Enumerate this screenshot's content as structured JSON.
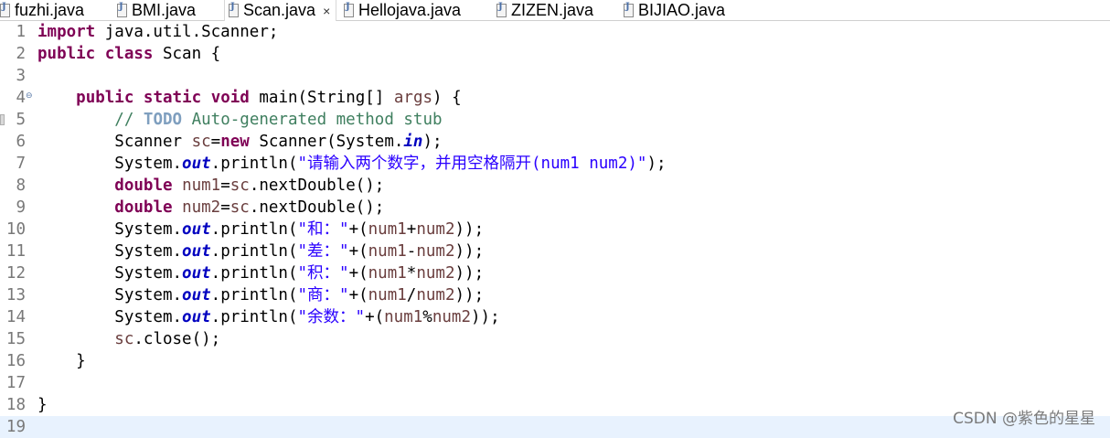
{
  "tabs": [
    {
      "label": "fuzhi.java",
      "active": false
    },
    {
      "label": "BMI.java",
      "active": false
    },
    {
      "label": "Scan.java",
      "active": true
    },
    {
      "label": "Hellojava.java",
      "active": false
    },
    {
      "label": "ZIZEN.java",
      "active": false
    },
    {
      "label": "BIJIAO.java",
      "active": false
    }
  ],
  "close_glyph": "×",
  "colors": {
    "keyword": "#7f0055",
    "static_field": "#0000c0",
    "string": "#2a00ff",
    "comment": "#3f7f5f",
    "todo": "#7f9fbf",
    "variable": "#6a3e3e",
    "current_line": "#e8f2fe"
  },
  "editor": {
    "current_line": 19,
    "lines": [
      {
        "n": "1",
        "tokens": [
          {
            "t": "import",
            "c": "kw"
          },
          {
            "t": " java.util.Scanner;"
          }
        ]
      },
      {
        "n": "2",
        "tokens": [
          {
            "t": "public",
            "c": "kw"
          },
          {
            "t": " "
          },
          {
            "t": "class",
            "c": "kw"
          },
          {
            "t": " Scan {"
          }
        ]
      },
      {
        "n": "3",
        "tokens": []
      },
      {
        "n": "4",
        "fold": "⊖",
        "tokens": [
          {
            "t": "    "
          },
          {
            "t": "public",
            "c": "kw"
          },
          {
            "t": " "
          },
          {
            "t": "static",
            "c": "kw"
          },
          {
            "t": " "
          },
          {
            "t": "void",
            "c": "kw"
          },
          {
            "t": " main(String[] "
          },
          {
            "t": "args",
            "c": "var"
          },
          {
            "t": ") {"
          }
        ]
      },
      {
        "n": "5",
        "marker": true,
        "tokens": [
          {
            "t": "        "
          },
          {
            "t": "// ",
            "c": "cm"
          },
          {
            "t": "TODO",
            "c": "todo"
          },
          {
            "t": " Auto-generated method stub",
            "c": "cm"
          }
        ]
      },
      {
        "n": "6",
        "tokens": [
          {
            "t": "        Scanner "
          },
          {
            "t": "sc",
            "c": "var"
          },
          {
            "t": "="
          },
          {
            "t": "new",
            "c": "kw"
          },
          {
            "t": " Scanner(System."
          },
          {
            "t": "in",
            "c": "fld"
          },
          {
            "t": ");"
          }
        ]
      },
      {
        "n": "7",
        "tokens": [
          {
            "t": "        System."
          },
          {
            "t": "out",
            "c": "fld"
          },
          {
            "t": ".println("
          },
          {
            "t": "\"请输入两个数字，并用空格隔开(num1 num2)\"",
            "c": "str"
          },
          {
            "t": ");"
          }
        ]
      },
      {
        "n": "8",
        "tokens": [
          {
            "t": "        "
          },
          {
            "t": "double",
            "c": "kw"
          },
          {
            "t": " "
          },
          {
            "t": "num1",
            "c": "var"
          },
          {
            "t": "="
          },
          {
            "t": "sc",
            "c": "var"
          },
          {
            "t": ".nextDouble();"
          }
        ]
      },
      {
        "n": "9",
        "tokens": [
          {
            "t": "        "
          },
          {
            "t": "double",
            "c": "kw"
          },
          {
            "t": " "
          },
          {
            "t": "num2",
            "c": "var"
          },
          {
            "t": "="
          },
          {
            "t": "sc",
            "c": "var"
          },
          {
            "t": ".nextDouble();"
          }
        ]
      },
      {
        "n": "10",
        "tokens": [
          {
            "t": "        System."
          },
          {
            "t": "out",
            "c": "fld"
          },
          {
            "t": ".println("
          },
          {
            "t": "\"和：\"",
            "c": "str"
          },
          {
            "t": "+("
          },
          {
            "t": "num1",
            "c": "var"
          },
          {
            "t": "+"
          },
          {
            "t": "num2",
            "c": "var"
          },
          {
            "t": "));"
          }
        ]
      },
      {
        "n": "11",
        "tokens": [
          {
            "t": "        System."
          },
          {
            "t": "out",
            "c": "fld"
          },
          {
            "t": ".println("
          },
          {
            "t": "\"差：\"",
            "c": "str"
          },
          {
            "t": "+("
          },
          {
            "t": "num1",
            "c": "var"
          },
          {
            "t": "-"
          },
          {
            "t": "num2",
            "c": "var"
          },
          {
            "t": "));"
          }
        ]
      },
      {
        "n": "12",
        "tokens": [
          {
            "t": "        System."
          },
          {
            "t": "out",
            "c": "fld"
          },
          {
            "t": ".println("
          },
          {
            "t": "\"积：\"",
            "c": "str"
          },
          {
            "t": "+("
          },
          {
            "t": "num1",
            "c": "var"
          },
          {
            "t": "*"
          },
          {
            "t": "num2",
            "c": "var"
          },
          {
            "t": "));"
          }
        ]
      },
      {
        "n": "13",
        "tokens": [
          {
            "t": "        System."
          },
          {
            "t": "out",
            "c": "fld"
          },
          {
            "t": ".println("
          },
          {
            "t": "\"商：\"",
            "c": "str"
          },
          {
            "t": "+("
          },
          {
            "t": "num1",
            "c": "var"
          },
          {
            "t": "/"
          },
          {
            "t": "num2",
            "c": "var"
          },
          {
            "t": "));"
          }
        ]
      },
      {
        "n": "14",
        "tokens": [
          {
            "t": "        System."
          },
          {
            "t": "out",
            "c": "fld"
          },
          {
            "t": ".println("
          },
          {
            "t": "\"余数：\"",
            "c": "str"
          },
          {
            "t": "+("
          },
          {
            "t": "num1",
            "c": "var"
          },
          {
            "t": "%"
          },
          {
            "t": "num2",
            "c": "var"
          },
          {
            "t": "));"
          }
        ]
      },
      {
        "n": "15",
        "tokens": [
          {
            "t": "        "
          },
          {
            "t": "sc",
            "c": "var"
          },
          {
            "t": ".close();"
          }
        ]
      },
      {
        "n": "16",
        "tokens": [
          {
            "t": "    }"
          }
        ]
      },
      {
        "n": "17",
        "tokens": []
      },
      {
        "n": "18",
        "tokens": [
          {
            "t": "}"
          }
        ]
      },
      {
        "n": "19",
        "tokens": []
      }
    ]
  },
  "watermark": "CSDN @紫色的星星"
}
